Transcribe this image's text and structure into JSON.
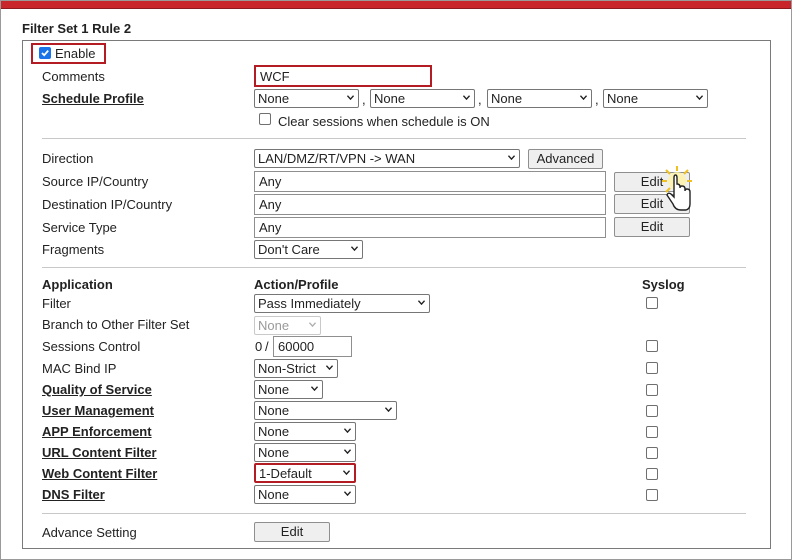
{
  "page": {
    "title": "Filter Set 1 Rule 2"
  },
  "enable": {
    "label": "Enable",
    "checked": true
  },
  "comments": {
    "label": "Comments",
    "value": "WCF"
  },
  "schedule": {
    "label": "Schedule Profile",
    "values": [
      "None",
      "None",
      "None",
      "None"
    ],
    "separator": ",",
    "clear_sessions_label": "Clear sessions when schedule is ON"
  },
  "direction": {
    "label": "Direction",
    "value": "LAN/DMZ/RT/VPN -> WAN",
    "advanced_label": "Advanced"
  },
  "source": {
    "label": "Source IP/Country",
    "value": "Any",
    "edit_label": "Edit"
  },
  "destination": {
    "label": "Destination IP/Country",
    "value": "Any",
    "edit_label": "Edit"
  },
  "service": {
    "label": "Service Type",
    "value": "Any",
    "edit_label": "Edit"
  },
  "fragments": {
    "label": "Fragments",
    "value": "Don't Care"
  },
  "headers": {
    "application": "Application",
    "action": "Action/Profile",
    "syslog": "Syslog"
  },
  "filter": {
    "label": "Filter",
    "value": "Pass Immediately"
  },
  "branch": {
    "label": "Branch to Other Filter Set",
    "value": "None"
  },
  "sessions": {
    "label": "Sessions Control",
    "current": "0",
    "sep": "/",
    "max": "60000"
  },
  "macbind": {
    "label": "MAC Bind IP",
    "value": "Non-Strict"
  },
  "qos": {
    "label": "Quality of Service",
    "value": "None"
  },
  "usermgmt": {
    "label": "User Management",
    "value": "None"
  },
  "appenf": {
    "label": "APP Enforcement",
    "value": "None"
  },
  "urlcf": {
    "label": "URL Content Filter",
    "value": "None"
  },
  "webcf": {
    "label": "Web Content Filter",
    "value": "1-Default"
  },
  "dnsf": {
    "label": "DNS Filter",
    "value": "None"
  },
  "advance": {
    "label": "Advance Setting",
    "edit_label": "Edit"
  },
  "colors": {
    "accent_red": "#b31c22",
    "checkbox_blue": "#1a73e8",
    "header_bar": "#c8262b"
  }
}
